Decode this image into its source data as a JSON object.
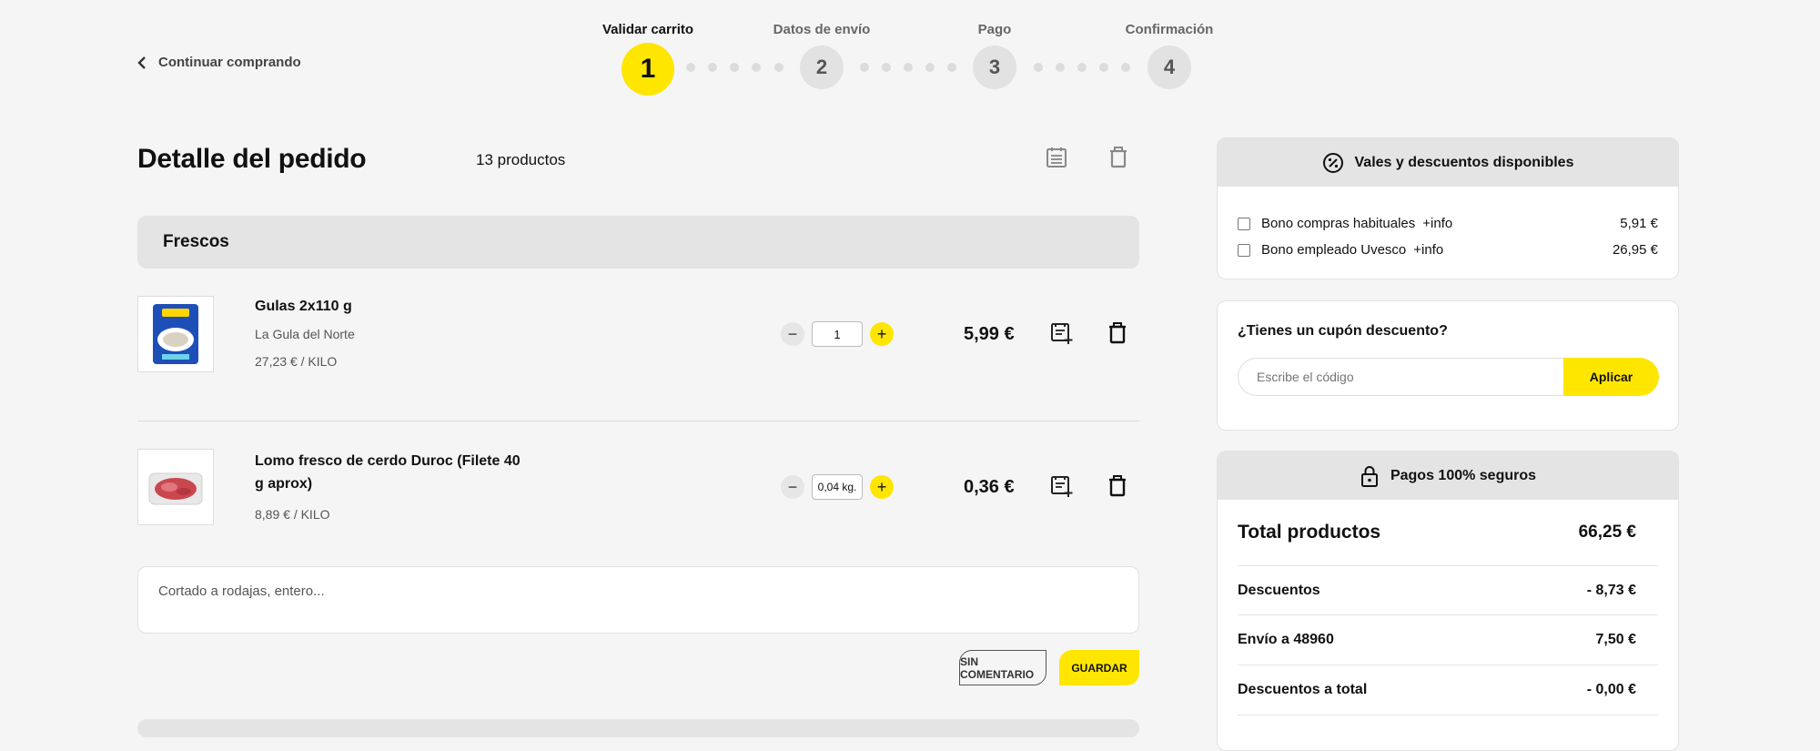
{
  "header": {
    "back_label": "Continuar comprando",
    "steps": [
      {
        "label": "Validar carrito",
        "number": "1",
        "active": true
      },
      {
        "label": "Datos de envío",
        "number": "2",
        "active": false
      },
      {
        "label": "Pago",
        "number": "3",
        "active": false
      },
      {
        "label": "Confirmación",
        "number": "4",
        "active": false
      }
    ]
  },
  "order": {
    "title": "Detalle del pedido",
    "count": "13 productos",
    "section": "Frescos",
    "products": [
      {
        "name": "Gulas 2x110 g",
        "brand": "La Gula del Norte",
        "unit_price": "27,23 € / KILO",
        "quantity": "1",
        "price": "5,99 €"
      },
      {
        "name": "Lomo fresco de cerdo Duroc (Filete 40 g aprox)",
        "brand": "",
        "unit_price": "8,89 € / KILO",
        "quantity": "0,04 kg.",
        "price": "0,36 €"
      }
    ],
    "comment_placeholder": "Cortado a rodajas, entero...",
    "no_comment_label": "SIN COMENTARIO",
    "save_label": "GUARDAR"
  },
  "vouchers": {
    "title": "Vales y descuentos disponibles",
    "items": [
      {
        "label": "Bono compras habituales",
        "info": "+info",
        "amount": "5,91 €"
      },
      {
        "label": "Bono empleado Uvesco",
        "info": "+info",
        "amount": "26,95 €"
      }
    ]
  },
  "coupon": {
    "title": "¿Tienes un cupón descuento?",
    "placeholder": "Escribe el código",
    "apply_label": "Aplicar"
  },
  "summary": {
    "title": "Pagos 100% seguros",
    "total_label": "Total productos",
    "total_value": "66,25 €",
    "rows": [
      {
        "label": "Descuentos",
        "value": "- 8,73 €"
      },
      {
        "label": "Envío a 48960",
        "value": "7,50 €"
      },
      {
        "label": "Descuentos a total",
        "value": "- 0,00 €"
      }
    ]
  },
  "colors": {
    "accent": "#ffe600",
    "background": "#f5f5f5",
    "panel": "#e4e4e4"
  }
}
